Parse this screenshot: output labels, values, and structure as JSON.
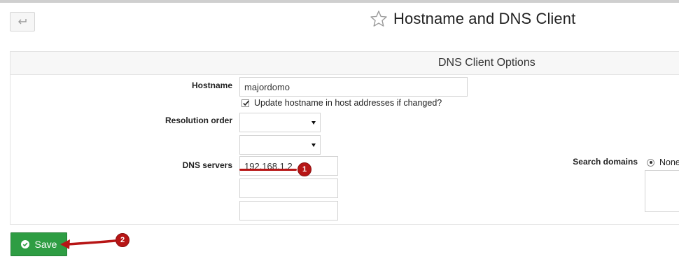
{
  "header": {
    "title": "Hostname and DNS Client"
  },
  "panel": {
    "title": "DNS Client Options"
  },
  "form": {
    "hostname_label": "Hostname",
    "hostname_value": "majordomo",
    "update_hosts_label": "Update hostname in host addresses if changed?",
    "update_hosts_checked": true,
    "resolution_order_label": "Resolution order",
    "resolution_order_values": [
      "",
      ""
    ],
    "dns_servers_label": "DNS servers",
    "dns_servers": [
      "192.168.1.2",
      "",
      ""
    ],
    "search_domains_label": "Search domains",
    "search_domains_option": "None",
    "search_domains_option_selected": true
  },
  "actions": {
    "save_label": "Save"
  },
  "annotations": {
    "step1": "1",
    "step2": "2"
  },
  "colors": {
    "save_button": "#2e9d43",
    "annotation": "#b71515"
  }
}
